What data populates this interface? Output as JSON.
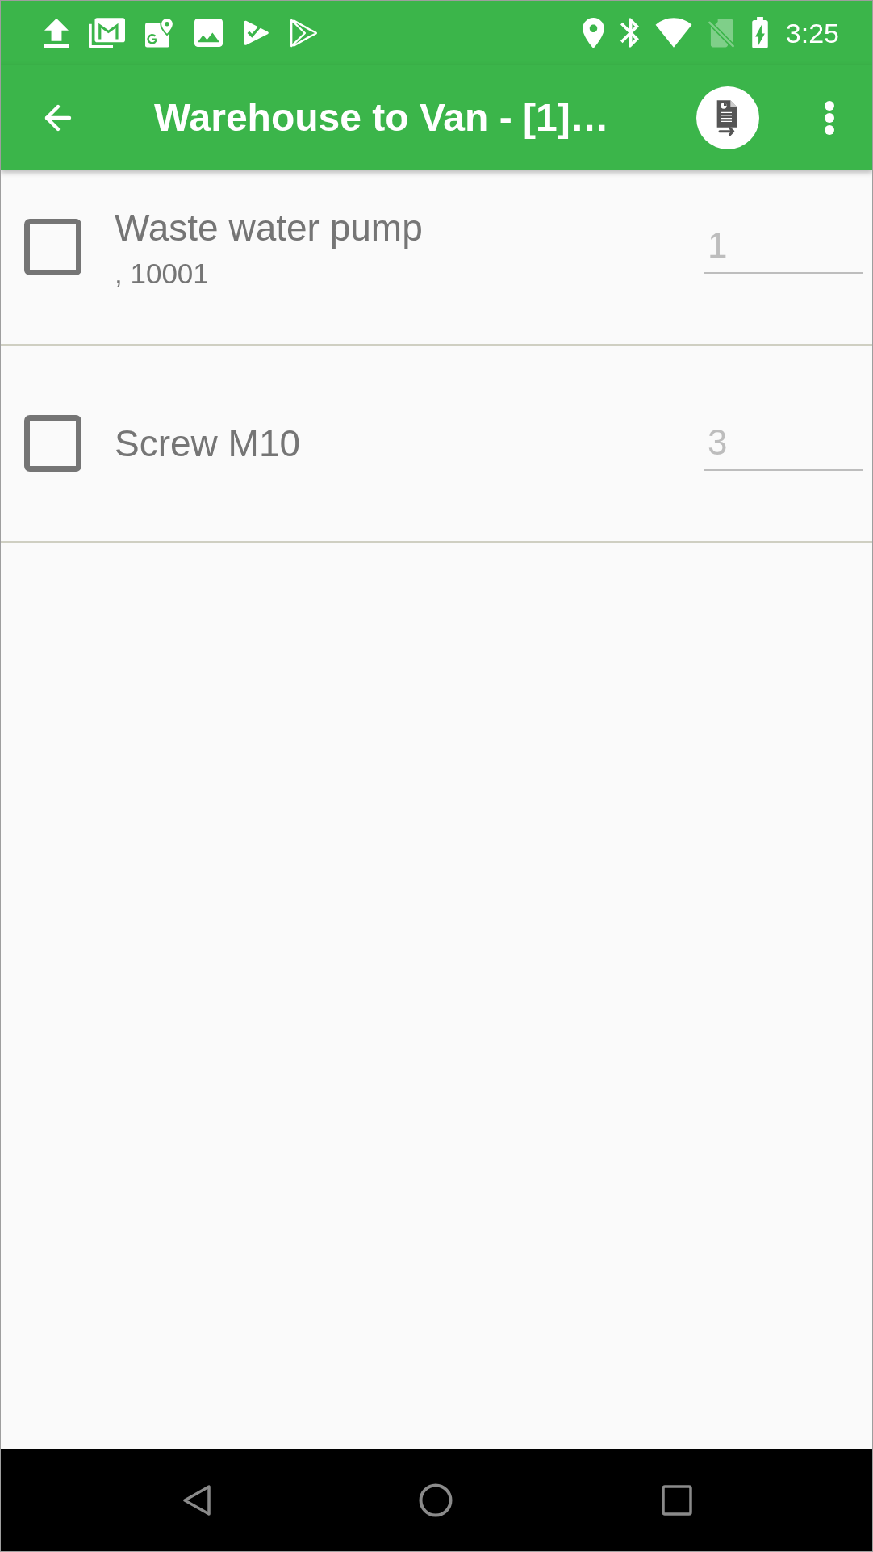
{
  "status_bar": {
    "time": "3:25"
  },
  "app_bar": {
    "title": "Warehouse to Van - [1]…"
  },
  "items": [
    {
      "name": "Waste water pump",
      "detail": ", 10001",
      "checked": false,
      "quantity": {
        "placeholder": "1"
      }
    },
    {
      "name": "Screw M10",
      "checked": false,
      "quantity": {
        "placeholder": "3"
      }
    }
  ]
}
